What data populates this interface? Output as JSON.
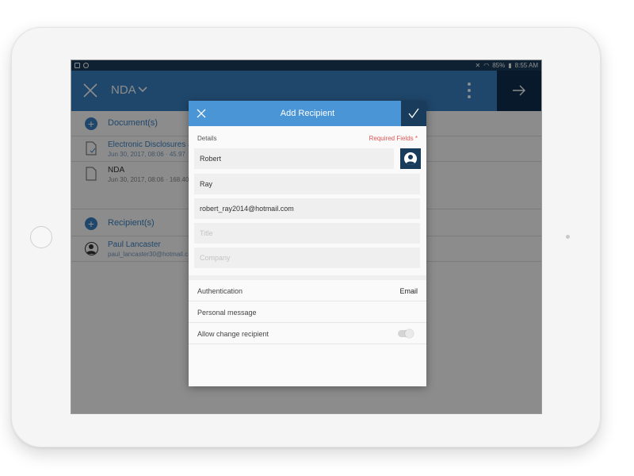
{
  "status_bar": {
    "battery": "85%",
    "time": "8:55 AM"
  },
  "app_bar": {
    "title": "NDA"
  },
  "documents": {
    "header": "Document(s)",
    "items": [
      {
        "name": "Electronic Disclosures a",
        "meta": "Jun 30, 2017, 08:06 · 45.97"
      },
      {
        "name": "NDA",
        "meta": "Jun 30, 2017, 08:06 · 168.40"
      }
    ]
  },
  "recipients": {
    "header": "Recipient(s)",
    "items": [
      {
        "name": "Paul Lancaster",
        "email": "paul_lancaster30@hotmail.c"
      }
    ]
  },
  "dialog": {
    "title": "Add Recipient",
    "details_label": "Details",
    "required_label": "Required Fields *",
    "fields": {
      "first_name": "Robert",
      "last_name": "Ray",
      "email": "robert_ray2014@hotmail.com",
      "title_placeholder": "Title",
      "company_placeholder": "Company"
    },
    "settings": {
      "authentication_label": "Authentication",
      "authentication_value": "Email",
      "personal_message_label": "Personal message",
      "allow_change_label": "Allow change recipient",
      "allow_change_enabled": false
    }
  }
}
